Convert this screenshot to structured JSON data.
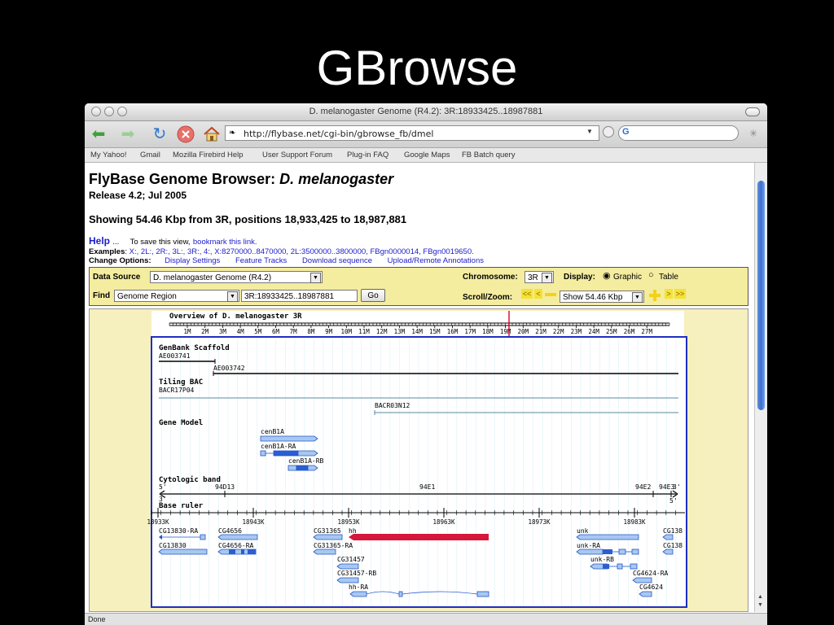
{
  "slide": {
    "title": "GBrowse"
  },
  "window": {
    "title": "D. melanogaster Genome (R4.2): 3R:18933425..18987881"
  },
  "toolbar": {
    "url": "http://flybase.net/cgi-bin/gbrowse_fb/dmel"
  },
  "bookmarks": [
    "My Yahoo!",
    "Gmail",
    "Mozilla Firebird Help",
    "User Support Forum",
    "Plug-in FAQ",
    "Google Maps",
    "FB Batch query"
  ],
  "page": {
    "heading_prefix": "FlyBase Genome Browser: ",
    "heading_species": "D. melanogaster",
    "release": "Release 4.2; Jul 2005",
    "showing": "Showing 54.46 Kbp from 3R, positions 18,933,425 to 18,987,881",
    "help_label": "Help",
    "help_dots": "...",
    "save_text": "To save this view,",
    "save_link": "bookmark this link.",
    "examples_label": "Examples",
    "examples_list": "X:, 2L:, 2R:, 3L:, 3R:, 4:, X:8270000..8470000, 2L:3500000..3800000, FBgn0000014, FBgn0019650.",
    "change_label": "Change Options:",
    "change_links": [
      "Display Settings",
      "Feature Tracks",
      "Download sequence",
      "Upload/Remote Annotations"
    ]
  },
  "form": {
    "data_source_label": "Data Source",
    "data_source_value": "D. melanogaster Genome (R4.2)",
    "find_label": "Find",
    "find_type": "Genome Region",
    "find_value": "3R:18933425..18987881",
    "go_label": "Go",
    "chromosome_label": "Chromosome:",
    "chromosome_value": "3R",
    "display_label": "Display:",
    "display_options": [
      "Graphic",
      "Table"
    ],
    "scroll_label": "Scroll/Zoom:",
    "zoom_value": "Show 54.46 Kbp"
  },
  "overview": {
    "title": "Overview of D. melanogaster 3R",
    "ticks": [
      "1M",
      "2M",
      "3M",
      "4M",
      "5M",
      "6M",
      "7M",
      "8M",
      "9M",
      "10M",
      "11M",
      "12M",
      "13M",
      "14M",
      "15M",
      "16M",
      "17M",
      "18M",
      "19M",
      "20M",
      "21M",
      "22M",
      "23M",
      "24M",
      "25M",
      "26M",
      "27M"
    ]
  },
  "tracks": {
    "genbank": {
      "title": "GenBank Scaffold",
      "labels": [
        "AE003741",
        "AE003742"
      ]
    },
    "tiling": {
      "title": "Tiling BAC",
      "labels": [
        "BACR17P04",
        "BACR03N12"
      ]
    },
    "gene_model": {
      "title": "Gene Model",
      "labels": [
        "cenB1A",
        "cenB1A-RA",
        "cenB1A-RB"
      ]
    },
    "cyto": {
      "title": "Cytologic band",
      "labels": [
        "5'",
        "94D13",
        "94E1",
        "94E2",
        "94E3",
        "3'",
        "3'",
        "5'"
      ]
    },
    "ruler": {
      "title": "Base ruler",
      "ticks": [
        "18933K",
        "18943K",
        "18953K",
        "18963K",
        "18973K",
        "18983K"
      ]
    },
    "genes": [
      "CG13830-RA",
      "CG13830",
      "CG4656",
      "CG4656-RA",
      "CG31365",
      "CG31365-RA",
      "CG31457",
      "CG31457-RB",
      "hh",
      "hh-RA",
      "unk",
      "unk-RA",
      "unk-RB",
      "CG4624-RA",
      "CG4624",
      "CG138",
      "CG138"
    ]
  },
  "status": {
    "text": "Done"
  },
  "colors": {
    "link": "#1c1ccc",
    "form_bg": "#f4ec9f",
    "panel_bg": "#f6efbe",
    "gene_fill": "#a8c8f0",
    "gene_stroke": "#2255cc",
    "hh": "#d6163a"
  }
}
